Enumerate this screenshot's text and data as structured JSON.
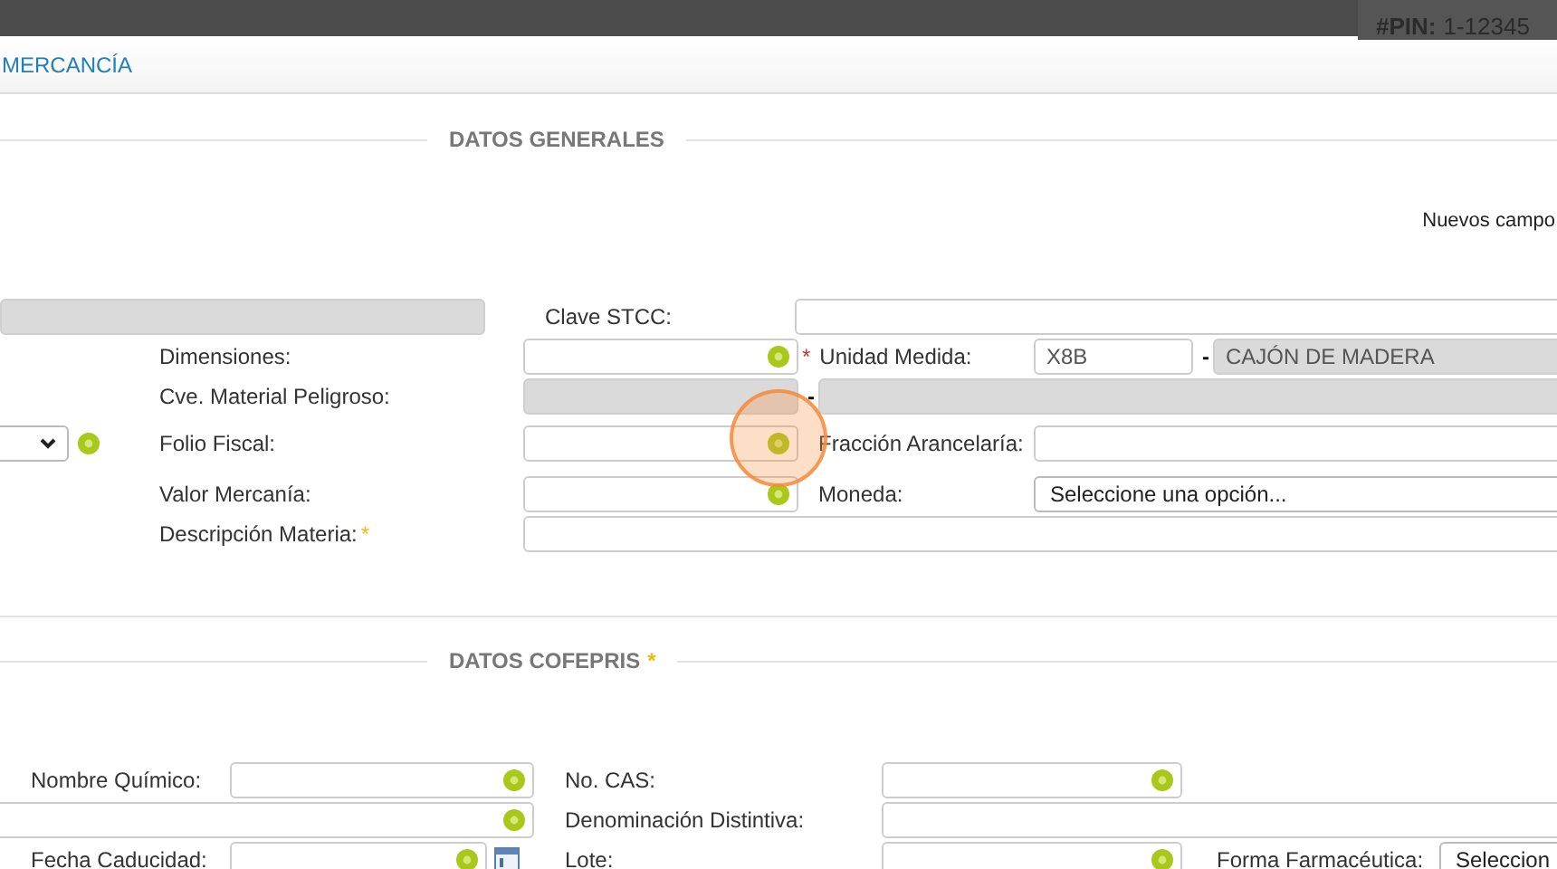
{
  "top_bar": {
    "pin_label": "#PIN:",
    "pin_value": "1-12345"
  },
  "panel": {
    "title": "MERCANCÍA"
  },
  "click_marker": true,
  "sections": [
    {
      "title": "DATOS GENERALES",
      "note": "Nuevos campo",
      "rows": [
        {
          "cells": [
            {
              "kind": "input",
              "disabled": true,
              "help": false
            },
            {
              "kind": "label",
              "text": "Clave STCC:"
            },
            {
              "kind": "input",
              "disabled": false,
              "help": false
            }
          ]
        },
        {
          "cells": [
            {
              "kind": "empty"
            },
            {
              "kind": "label",
              "text": "Dimensiones:"
            },
            {
              "kind": "input",
              "disabled": false,
              "help": true
            },
            {
              "kind": "label",
              "text": "Unidad Medida:",
              "mark": "*",
              "mark_first": true,
              "color": "#c0392b"
            },
            {
              "kind": "input",
              "disabled": false,
              "help": false,
              "value": "X8B"
            },
            {
              "kind": "sep",
              "text": "-"
            },
            {
              "kind": "input",
              "disabled": true,
              "help": false,
              "value": "CAJÓN DE MADERA"
            }
          ]
        },
        {
          "cells": [
            {
              "kind": "empty"
            },
            {
              "kind": "label",
              "text": "Cve. Material Peligroso:"
            },
            {
              "kind": "input",
              "disabled": true,
              "help": false
            },
            {
              "kind": "sep",
              "text": "-"
            },
            {
              "kind": "input",
              "disabled": true,
              "help": false
            }
          ]
        },
        {
          "cells": [
            {
              "kind": "select",
              "help": true
            },
            {
              "kind": "label",
              "text": "Folio Fiscal:"
            },
            {
              "kind": "input",
              "disabled": false,
              "help": true
            },
            {
              "kind": "label",
              "text": "Fracción Arancelaría:"
            },
            {
              "kind": "input",
              "disabled": false,
              "help": false
            }
          ]
        },
        {
          "cells": [
            {
              "kind": "empty"
            },
            {
              "kind": "label",
              "text": "Valor Mercanía:"
            },
            {
              "kind": "input",
              "disabled": false,
              "help": true
            },
            {
              "kind": "label",
              "text": "Moneda:"
            },
            {
              "kind": "select",
              "help": false,
              "value": "Seleccione una opción..."
            }
          ]
        },
        {
          "cells": [
            {
              "kind": "empty"
            },
            {
              "kind": "label",
              "text": "Descripción Materia:",
              "mark": "*",
              "mark_first": false,
              "color": "#f2b90c"
            },
            {
              "kind": "input",
              "disabled": false,
              "help": false
            }
          ]
        }
      ]
    },
    {
      "title": "DATOS COFEPRIS",
      "mark": "*",
      "rows": [
        {
          "cells": [
            {
              "kind": "label",
              "text": "Nombre Químico:"
            },
            {
              "kind": "input",
              "disabled": false,
              "help": true
            },
            {
              "kind": "label",
              "text": "No. CAS:"
            },
            {
              "kind": "input",
              "disabled": false,
              "help": true
            }
          ]
        },
        {
          "cells": [
            {
              "kind": "input",
              "disabled": false,
              "help": true
            },
            {
              "kind": "label",
              "text": "Denominación Distintiva:"
            },
            {
              "kind": "input",
              "disabled": false,
              "help": false
            }
          ]
        },
        {
          "cells": [
            {
              "kind": "label",
              "text": "Fecha Caducidad:"
            },
            {
              "kind": "input",
              "disabled": false,
              "help": true,
              "calendar": true
            },
            {
              "kind": "label",
              "text": "Lote:"
            },
            {
              "kind": "input",
              "disabled": false,
              "help": true
            },
            {
              "kind": "label",
              "text": "Forma Farmacéutica:"
            },
            {
              "kind": "select",
              "help": false,
              "value": "Seleccion"
            }
          ]
        }
      ]
    }
  ]
}
